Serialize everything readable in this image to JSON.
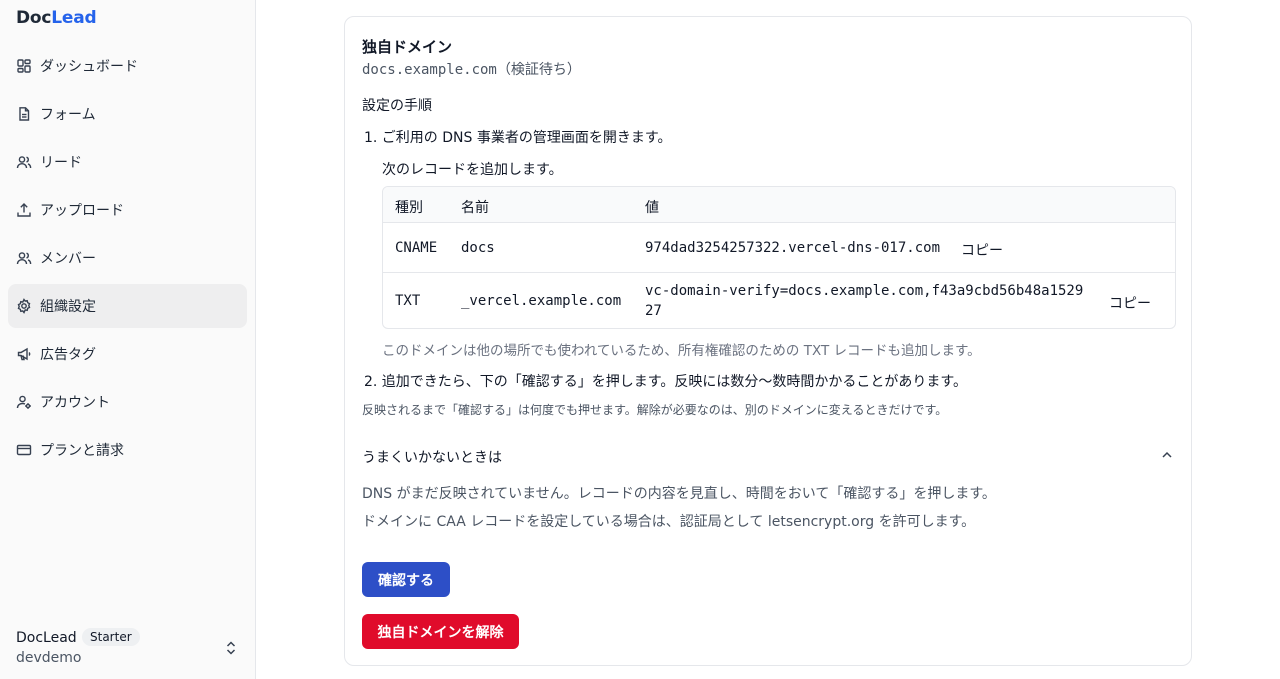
{
  "brand": {
    "part1": "Doc",
    "part2": "Lead"
  },
  "sidebar": {
    "items": [
      {
        "label": "ダッシュボード",
        "icon": "dashboard-icon"
      },
      {
        "label": "フォーム",
        "icon": "document-icon"
      },
      {
        "label": "リード",
        "icon": "users-icon"
      },
      {
        "label": "アップロード",
        "icon": "upload-icon"
      },
      {
        "label": "メンバー",
        "icon": "members-icon"
      },
      {
        "label": "組織設定",
        "icon": "gear-icon",
        "active": true
      },
      {
        "label": "広告タグ",
        "icon": "megaphone-icon"
      },
      {
        "label": "アカウント",
        "icon": "user-cog-icon"
      },
      {
        "label": "プランと請求",
        "icon": "credit-card-icon"
      }
    ],
    "org": {
      "name": "DocLead",
      "plan": "Starter",
      "sub": "devdemo"
    }
  },
  "domain": {
    "title": "独自ドメイン",
    "hostname": "docs.example.com",
    "status": "（検証待ち）",
    "section_label": "設定の手順",
    "step1": "1. ご利用の DNS 事業者の管理画面を開きます。",
    "step1_sub": "次のレコードを追加します。",
    "table": {
      "headers": [
        "種別",
        "名前",
        "値"
      ],
      "rows": [
        {
          "type": "CNAME",
          "name": "docs",
          "value": "974dad3254257322.vercel-dns-017.com",
          "copy": "コピー"
        },
        {
          "type": "TXT",
          "name": "_vercel.example.com",
          "value_line1": "vc-domain-verify=docs.example.com,f43a9cbd56b48a1529",
          "value_line2": "27",
          "copy": "コピー"
        }
      ]
    },
    "txt_note": "このドメインは他の場所でも使われているため、所有権確認のための TXT レコードも追加します。",
    "step2": "2. 追加できたら、下の「確認する」を押します。反映には数分〜数時間かかることがあります。",
    "step2_note": "反映されるまで「確認する」は何度でも押せます。解除が必要なのは、別のドメインに変えるときだけです。",
    "troubleshoot": {
      "title": "うまくいかないときは",
      "p1": "DNS がまだ反映されていません。レコードの内容を見直し、時間をおいて「確認する」を押します。",
      "p2": "ドメインに CAA レコードを設定している場合は、認証局として letsencrypt.org を許可します。"
    },
    "confirm_label": "確認する",
    "remove_label": "独自ドメインを解除"
  },
  "colors": {
    "accent": "#2d4fc7",
    "danger": "#e00b2b",
    "brand_lead": "#2563eb"
  }
}
